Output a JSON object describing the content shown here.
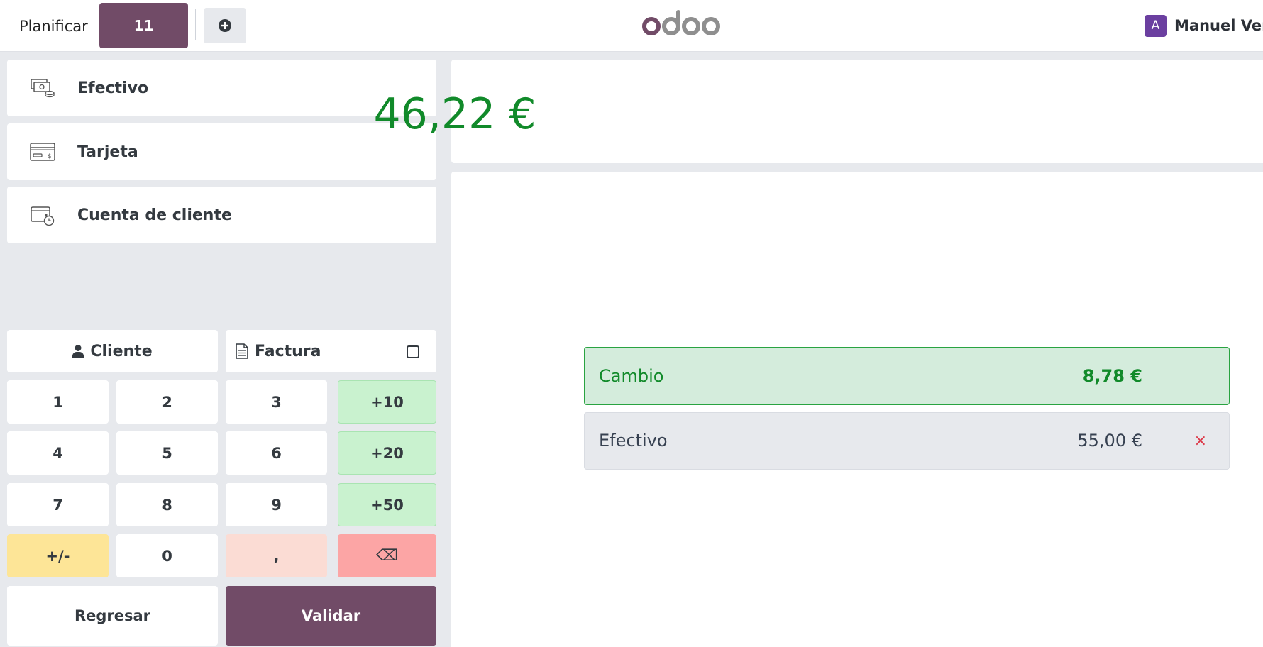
{
  "topbar": {
    "plan_label": "Planificar",
    "order_tab": "11",
    "add_icon": "plus-circle-icon",
    "logo_text": "odoo",
    "user_initial": "A",
    "user_name": "Manuel Verd"
  },
  "payment_methods": [
    {
      "label": "Efectivo",
      "icon": "cash-icon"
    },
    {
      "label": "Tarjeta",
      "icon": "card-icon"
    },
    {
      "label": "Cuenta de cliente",
      "icon": "wallet-clock-icon"
    }
  ],
  "actions": {
    "customer_label": "Cliente",
    "invoice_label": "Factura"
  },
  "numpad": {
    "k1": "1",
    "k2": "2",
    "k3": "3",
    "k10": "+10",
    "k4": "4",
    "k5": "5",
    "k6": "6",
    "k20": "+20",
    "k7": "7",
    "k8": "8",
    "k9": "9",
    "k50": "+50",
    "sign": "+/-",
    "k0": "0",
    "decimal": ",",
    "backspace": "⌫"
  },
  "footer": {
    "back_label": "Regresar",
    "validate_label": "Validar"
  },
  "summary": {
    "total": "46,22 €"
  },
  "payment_lines": {
    "change_label": "Cambio",
    "change_value": "8,78 €",
    "cash_label": "Efectivo",
    "cash_value": "55,00 €",
    "remove_glyph": "×"
  },
  "colors": {
    "brand": "#714b67",
    "success": "#118a2a",
    "danger": "#dc3545"
  }
}
